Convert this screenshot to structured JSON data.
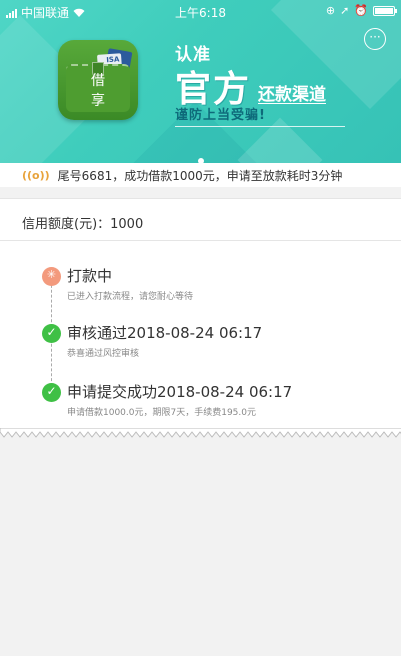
{
  "status_bar": {
    "carrier": "中国联通",
    "time": "上午6:18"
  },
  "banner": {
    "app_label": "借 享",
    "card_text": "ISA",
    "slogan_line1": "认准",
    "slogan_line2": "官方",
    "slogan_line3": "还款渠道",
    "slogan_line4": "谨防上当受骗!",
    "more_icon": "···"
  },
  "notice": {
    "icon": "broadcast-icon",
    "text": "尾号6681，成功借款1000元，申请至放款耗时3分钟"
  },
  "credit": {
    "label": "信用额度(元)",
    "value": "1000",
    "text": "信用额度(元)：1000"
  },
  "steps": [
    {
      "status": "in-progress",
      "title": "打款中",
      "subtitle": "已进入打款流程，请您耐心等待"
    },
    {
      "status": "done",
      "title": "审核通过2018-08-24 06:17",
      "subtitle": "恭喜通过风控审核"
    },
    {
      "status": "done",
      "title": "申请提交成功2018-08-24 06:17",
      "subtitle": "申请借款1000.0元，期限7天，手续费195.0元"
    }
  ],
  "colors": {
    "banner_teal": "#3fcdbc",
    "success_green": "#3fc045",
    "progress_orange": "#f39a7d",
    "notice_icon": "#e8a33c"
  }
}
